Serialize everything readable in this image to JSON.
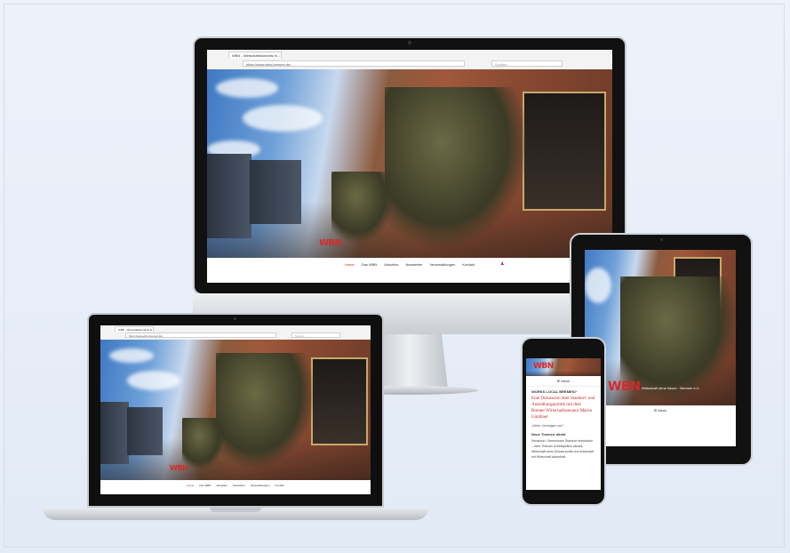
{
  "browser": {
    "tab_title": "WBN - Wirtschaftsbündnis N...",
    "url": "https://www.wbn-bremen.de/",
    "search_placeholder": "Suchen"
  },
  "brand": {
    "logo_text": "WBN",
    "tagline": "Wirtschaft ohne Neuer · Bremen e.V.",
    "accent_color": "#c62828"
  },
  "nav": {
    "items": [
      "Home",
      "Das WBN",
      "Aktuelles",
      "Newsletter",
      "Veranstaltungen",
      "Kontakt"
    ],
    "active_index": 0
  },
  "phone": {
    "menu_label": "☰ Menü",
    "kicker": "WORKS LOCAL BREMEN?",
    "headline": "Eine Diskussion über Standort- und Ansiedlungspolitik mit dem Bremer Wirtschaftssenator Martin Günthner",
    "quote": "„Mehr Verfolgen an!“",
    "subhead": "Neue Themen direkt",
    "body": "Senatorin: Gemeinsam Standort entwickeln – über Themen Arbeitsplätze aktuell, Wirtschaft beim Schwerpunkt und entwickelt mit Wirtschaft dauerhaft."
  },
  "tablet": {
    "menu_label": "☰ Menü"
  }
}
